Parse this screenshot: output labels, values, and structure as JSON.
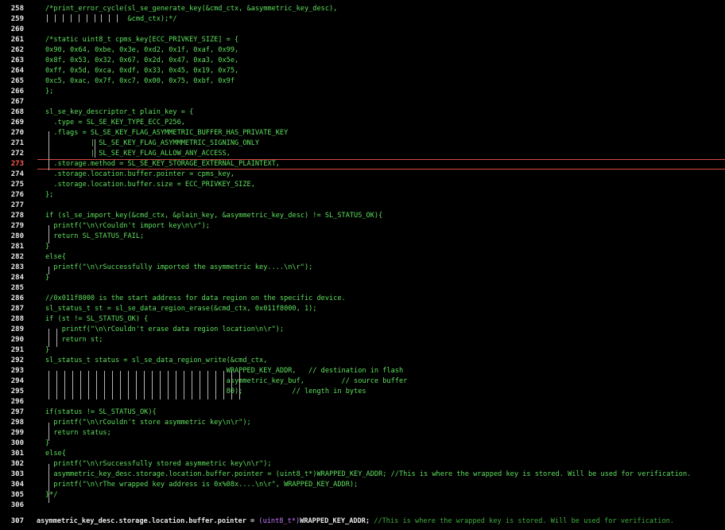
{
  "editor": {
    "current_line": "273",
    "lines": [
      {
        "n": "258",
        "text": "/*print_error_cycle(sl_se_generate_key(&cmd_ctx, &asymmetric_key_desc),"
      },
      {
        "n": "259",
        "text": "                    &cmd_ctx);*/"
      },
      {
        "n": "260",
        "text": ""
      },
      {
        "n": "261",
        "text": "/*static uint8_t cpms_key[ECC_PRIVKEY_SIZE] = {"
      },
      {
        "n": "262",
        "text": "0x90, 0x64, 0xbe, 0x3e, 0xd2, 0x1f, 0xaf, 0x99,"
      },
      {
        "n": "263",
        "text": "0x8f, 0x53, 0x32, 0x67, 0x2d, 0x47, 0xa3, 0x5e,"
      },
      {
        "n": "264",
        "text": "0xff, 0x5d, 0xca, 0xdf, 0x33, 0x45, 0x19, 0x75,"
      },
      {
        "n": "265",
        "text": "0xc5, 0xac, 0x7f, 0xc7, 0x00, 0x75, 0xbf, 0x9f"
      },
      {
        "n": "266",
        "text": "};"
      },
      {
        "n": "267",
        "text": ""
      },
      {
        "n": "268",
        "text": "sl_se_key_descriptor_t plain_key = {"
      },
      {
        "n": "269",
        "text": "  .type = SL_SE_KEY_TYPE_ECC_P256,"
      },
      {
        "n": "270",
        "text": "  .flags = SL_SE_KEY_FLAG_ASYMMETRIC_BUFFER_HAS_PRIVATE_KEY"
      },
      {
        "n": "271",
        "text": "           | SL_SE_KEY_FLAG_ASYMMMETRIC_SIGNING_ONLY"
      },
      {
        "n": "272",
        "text": "           | SL_SE_KEY_FLAG_ALLOW_ANY_ACCESS,"
      },
      {
        "n": "273",
        "text": "  .storage.method = SL_SE_KEY_STORAGE_EXTERNAL_PLAINTEXT,"
      },
      {
        "n": "274",
        "text": "  .storage.location.buffer.pointer = cpms_key,"
      },
      {
        "n": "275",
        "text": "  .storage.location.buffer.size = ECC_PRIVKEY_SIZE,"
      },
      {
        "n": "276",
        "text": "};"
      },
      {
        "n": "277",
        "text": ""
      },
      {
        "n": "278",
        "text": "if (sl_se_import_key(&cmd_ctx, &plain_key, &asymmetric_key_desc) != SL_STATUS_OK){"
      },
      {
        "n": "279",
        "text": "  printf(\"\\n\\rCouldn't import key\\n\\r\");"
      },
      {
        "n": "280",
        "text": "  return SL_STATUS_FAIL;"
      },
      {
        "n": "281",
        "text": "}"
      },
      {
        "n": "282",
        "text": "else{"
      },
      {
        "n": "283",
        "text": "  printf(\"\\n\\rSuccessfully imported the asymmetric key....\\n\\r\");"
      },
      {
        "n": "284",
        "text": "}"
      },
      {
        "n": "285",
        "text": ""
      },
      {
        "n": "286",
        "text": "//0x011f8000 is the start address for data region on the specific device."
      },
      {
        "n": "287",
        "text": "sl_status_t st = sl_se_data_region_erase(&cmd_ctx, 0x011f8000, 1);"
      },
      {
        "n": "288",
        "text": "if (st != SL_STATUS_OK) {"
      },
      {
        "n": "289",
        "text": "    printf(\"\\n\\rCouldn't erase data region location\\n\\r\");"
      },
      {
        "n": "290",
        "text": "    return st;"
      },
      {
        "n": "291",
        "text": "}"
      },
      {
        "n": "292",
        "text": "sl_status_t status = sl_se_data_region_write(&cmd_ctx,"
      },
      {
        "n": "293",
        "text": "                                            WRAPPED_KEY_ADDR,   // destination in flash"
      },
      {
        "n": "294",
        "text": "                                            asymmetric_key_buf,         // source buffer"
      },
      {
        "n": "295",
        "text": "                                            80);            // length in bytes"
      },
      {
        "n": "296",
        "text": ""
      },
      {
        "n": "297",
        "text": "if(status != SL_STATUS_OK){"
      },
      {
        "n": "298",
        "text": "  printf(\"\\n\\rCouldn't store asymmetric key\\n\\r\");"
      },
      {
        "n": "299",
        "text": "  return status;"
      },
      {
        "n": "300",
        "text": "}"
      },
      {
        "n": "301",
        "text": "else{"
      },
      {
        "n": "302",
        "text": "  printf(\"\\n\\rSuccessfully stored asymmetric key\\n\\r\");"
      },
      {
        "n": "303",
        "text": "  asymmetric_key_desc.storage.location.buffer.pointer = (uint8_t*)WRAPPED_KEY_ADDR; //This is where the wrapped key is stored. Will be used for verification."
      },
      {
        "n": "304",
        "text": "  printf(\"\\n\\rThe wrapped key address is 0x%08x....\\n\\r\", WRAPPED_KEY_ADDR);"
      },
      {
        "n": "305",
        "text": "}*/"
      },
      {
        "n": "306",
        "text": ""
      }
    ]
  },
  "bottom_line": {
    "n": "307",
    "part1": "asymmetric_key_desc.storage.location.buffer.pointer = ",
    "part2": "(uint8_t*)",
    "part3": "WRAPPED_KEY_ADDR; ",
    "part4": "//This is where the wrapped key is stored. Will be used for verification."
  },
  "colors": {
    "background": "#000000",
    "comment_text": "#5ee05e",
    "line_numbers": "#e8e8e8",
    "current_line_number": "#ff5a4e",
    "highlight_border": "#d94a3e",
    "cast_keyword": "#c878ff"
  }
}
